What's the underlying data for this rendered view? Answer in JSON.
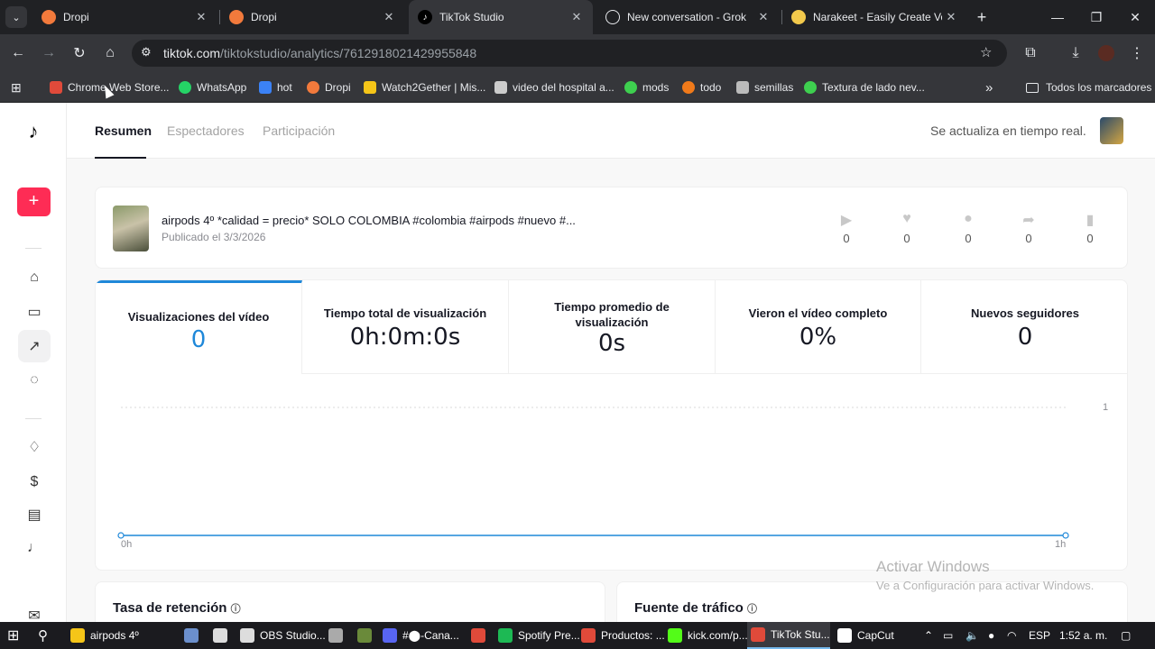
{
  "browser": {
    "tabs": [
      {
        "label": "Dropi",
        "icon": "dropi-icon",
        "color": "#f27a3c"
      },
      {
        "label": "Dropi",
        "icon": "dropi-icon",
        "color": "#f27a3c"
      },
      {
        "label": "TikTok Studio",
        "icon": "tiktok-icon",
        "color": "#000000",
        "active": true
      },
      {
        "label": "New conversation - Grok",
        "icon": "grok-icon",
        "color": "#ffffff"
      },
      {
        "label": "Narakeet - Easily Create Voic",
        "icon": "narakeet-icon",
        "color": "#f2c94c"
      }
    ],
    "new_tab": "+",
    "window_controls": {
      "minimize": "—",
      "maximize": "❐",
      "close": "✕"
    },
    "url_host": "tiktok.com",
    "url_path": "/tiktokstudio/analytics/7612918021429955848",
    "bookmarks": [
      {
        "label": "Chrome Web Store...",
        "color": "#e04a3a"
      },
      {
        "label": "WhatsApp",
        "color": "#25d366"
      },
      {
        "label": "hot",
        "color": "#3b82f6"
      },
      {
        "label": "Dropi",
        "color": "#f27a3c"
      },
      {
        "label": "Watch2Gether | Mis...",
        "color": "#f5c518"
      },
      {
        "label": "video del hospital a...",
        "color": "#cccccc"
      },
      {
        "label": "mods",
        "color": "#3ecf4f"
      },
      {
        "label": "todo",
        "color": "#f07a1a"
      },
      {
        "label": "semillas",
        "color": "#bbbbbb"
      },
      {
        "label": "Textura de lado nev...",
        "color": "#3ecf4f"
      }
    ],
    "bookmarks_more": "»",
    "all_bookmarks": "Todos los marcadores"
  },
  "studio": {
    "tabs": [
      {
        "label": "Resumen",
        "active": true
      },
      {
        "label": "Espectadores"
      },
      {
        "label": "Participación"
      }
    ],
    "realtime": "Se actualiza en tiempo real.",
    "video": {
      "title": "airpods 4º *calidad = precio* SOLO COLOMBIA #colombia #airpods #nuevo #...",
      "published": "Publicado el 3/3/2026",
      "stats": [
        {
          "icon": "play-icon",
          "value": "0"
        },
        {
          "icon": "heart-icon",
          "value": "0"
        },
        {
          "icon": "comment-icon",
          "value": "0"
        },
        {
          "icon": "share-icon",
          "value": "0"
        },
        {
          "icon": "bookmark-icon",
          "value": "0"
        }
      ]
    },
    "metrics": [
      {
        "label": "Visualizaciones del vídeo",
        "value": "0",
        "active": true
      },
      {
        "label": "Tiempo total de visualización",
        "value": "0h:0m:0s"
      },
      {
        "label": "Tiempo promedio de visualización",
        "value": "0s"
      },
      {
        "label": "Vieron el vídeo completo",
        "value": "0%"
      },
      {
        "label": "Nuevos seguidores",
        "value": "0"
      }
    ],
    "chart_data": {
      "type": "line",
      "x": [
        "0h",
        "1h"
      ],
      "series": [
        {
          "values": [
            0,
            0
          ]
        }
      ],
      "xlabel": "",
      "ylabel": "",
      "ylim": [
        0,
        1
      ],
      "y_tick_label": "1",
      "color": "#1f88d9",
      "grid": true
    },
    "sections": {
      "retention": "Tasa de retención",
      "traffic": "Fuente de tráfico"
    },
    "add_button": "+"
  },
  "watermark": {
    "title": "Activar Windows",
    "subtitle": "Ve a Configuración para activar Windows."
  },
  "taskbar": {
    "items": [
      {
        "label": "airpods 4º",
        "color": "#f5c518"
      },
      {
        "label": "",
        "color": "#6b8fcc"
      },
      {
        "label": "",
        "color": "#dddddd"
      },
      {
        "label": "OBS Studio...",
        "color": "#dddddd"
      },
      {
        "label": "",
        "color": "#aaaaaa"
      },
      {
        "label": "",
        "color": "#6a8a3a"
      },
      {
        "label": "#⬤-Cana...",
        "color": "#5865f2"
      },
      {
        "label": "",
        "color": "#e04a3a"
      },
      {
        "label": "Spotify Pre...",
        "color": "#1db954"
      },
      {
        "label": "Productos: ...",
        "color": "#e04a3a"
      },
      {
        "label": "kick.com/p...",
        "color": "#53fc18"
      },
      {
        "label": "TikTok Stu...",
        "color": "#e04a3a",
        "active": true
      },
      {
        "label": "CapCut",
        "color": "#ffffff"
      }
    ],
    "language": "ESP",
    "time": "1:52 a. m."
  }
}
